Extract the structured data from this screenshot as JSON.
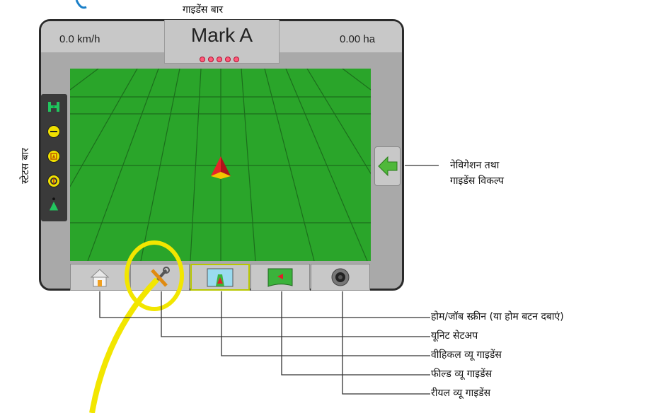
{
  "labels": {
    "guidance_bar": "गाइडेंस बार",
    "status_bar": "स्टेटस बार",
    "navigation_options": [
      "नेविगेशन तथा",
      "गाइडेंस विकल्प"
    ],
    "home_job": "होम/जॉब स्क्रीन (या होम बटन दबाएं)",
    "unit_setup": "यूनिट सेटअप",
    "vehicle_view": "वीहिकल व्यू गाइडेंस",
    "field_view": "फील्ड व्यू गाइडेंस",
    "real_view": "रीयल व्यू गाइडेंस"
  },
  "screen": {
    "speed": "0.0 km/h",
    "area": "0.00 ha",
    "mark": "Mark A"
  },
  "icons": {
    "status": [
      "implement-icon",
      "boom-icon",
      "gnss-icon",
      "steering-icon",
      "vehicle-icon"
    ],
    "nav": "back-arrow-icon",
    "tabs": [
      "home-icon",
      "tools-icon",
      "vehicle-view-icon",
      "field-view-icon",
      "camera-icon"
    ]
  },
  "colors": {
    "field": "#2aa52a",
    "highlight": "#f2e600",
    "bezel": "#2a2a2a"
  }
}
